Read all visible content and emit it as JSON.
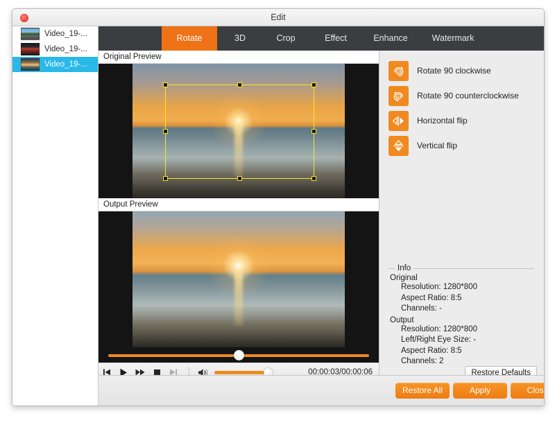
{
  "window": {
    "title": "Edit",
    "close_button": "close"
  },
  "sidebar": {
    "items": [
      {
        "label": "Video_19-...",
        "selected": false
      },
      {
        "label": "Video_19-...",
        "selected": false
      },
      {
        "label": "Video_19-...",
        "selected": true
      }
    ]
  },
  "tabs": [
    {
      "label": "Rotate",
      "active": true
    },
    {
      "label": "3D",
      "active": false
    },
    {
      "label": "Crop",
      "active": false
    },
    {
      "label": "Effect",
      "active": false
    },
    {
      "label": "Enhance",
      "active": false
    },
    {
      "label": "Watermark",
      "active": false
    }
  ],
  "previews": {
    "original_header": "Original Preview",
    "output_header": "Output Preview"
  },
  "transport": {
    "timecode": "00:00:03/00:00:06",
    "buttons": [
      "previous-frame",
      "play",
      "fast-forward",
      "stop",
      "next-frame"
    ]
  },
  "rotate_actions": [
    {
      "label": "Rotate 90 clockwise",
      "icon": "rotate-cw-90-icon"
    },
    {
      "label": "Rotate 90 counterclockwise",
      "icon": "rotate-ccw-90-icon"
    },
    {
      "label": "Horizontal flip",
      "icon": "flip-horizontal-icon"
    },
    {
      "label": "Vertical flip",
      "icon": "flip-vertical-icon"
    }
  ],
  "info": {
    "legend": "Info",
    "original_label": "Original",
    "original": [
      "Resolution: 1280*800",
      "Aspect Ratio: 8:5",
      "Channels: -"
    ],
    "output_label": "Output",
    "output": [
      "Resolution: 1280*800",
      "Left/Right Eye Size: -",
      "Aspect Ratio: 8:5",
      "Channels: 2"
    ]
  },
  "buttons": {
    "restore_defaults": "Restore Defaults",
    "restore_all": "Restore All",
    "apply": "Apply",
    "close": "Close"
  },
  "colors": {
    "accent_orange": "#ef7216",
    "button_orange": "#f79526",
    "selection_blue": "#29b8e8",
    "tabbar_dark": "#3b3d40",
    "crop_yellow": "#f7e724"
  }
}
